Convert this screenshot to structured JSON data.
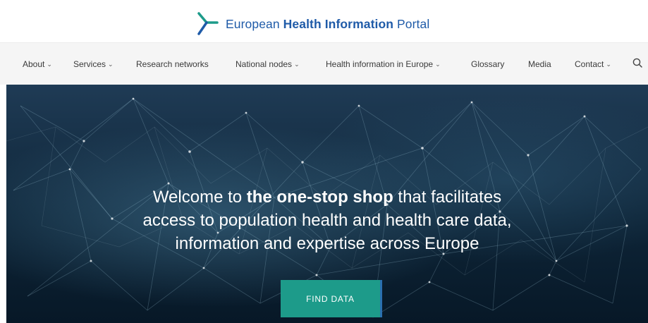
{
  "header": {
    "logo_icon": "portal-logo-icon",
    "logo_text_pre": "European ",
    "logo_text_bold": "Health Information",
    "logo_text_post": " Portal",
    "brand_color": "#1f5ba8",
    "accent_color": "#1d9b8a"
  },
  "nav": {
    "items": [
      {
        "label": "About",
        "dropdown": true
      },
      {
        "label": "Services",
        "dropdown": true
      },
      {
        "label": "Research networks",
        "dropdown": false
      },
      {
        "label": "National nodes",
        "dropdown": true
      },
      {
        "label": "Health information in Europe",
        "dropdown": true
      },
      {
        "label": "Glossary",
        "dropdown": false
      },
      {
        "label": "Media",
        "dropdown": false
      },
      {
        "label": "Contact",
        "dropdown": true
      }
    ],
    "chevron": "⌄",
    "search_icon": "search-icon"
  },
  "hero": {
    "line1_pre": "Welcome to ",
    "line1_bold": "the one-stop shop",
    "line1_post": " that facilitates",
    "line2": "access to population health and health care data,",
    "line3": "information and expertise across Europe",
    "cta_label": "FIND DATA"
  }
}
